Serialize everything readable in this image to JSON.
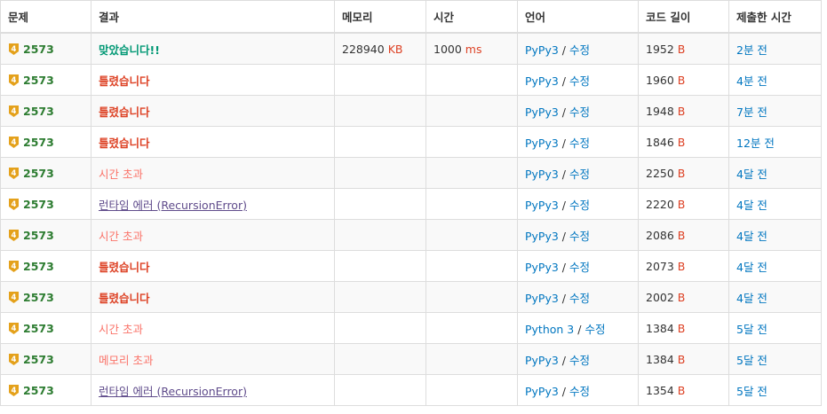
{
  "headers": [
    "문제",
    "결과",
    "메모리",
    "시간",
    "언어",
    "코드 길이",
    "제출한 시간"
  ],
  "tier_badge": "4",
  "colors": {
    "tier": "#e4a11b",
    "problem": "#2e7d32",
    "accepted": "#009874",
    "wrong": "#dd4124",
    "timeout": "#fa7268",
    "runtime": "#5f4b8b",
    "link": "#0076c0"
  },
  "rows": [
    {
      "problem": "2573",
      "result": "맞았습니다!!",
      "result_type": "ac",
      "memory": "228940",
      "memory_unit": "KB",
      "time": "1000",
      "time_unit": "ms",
      "language": "PyPy3",
      "edit": "수정",
      "length": "1952",
      "length_unit": "B",
      "submitted": "2분 전"
    },
    {
      "problem": "2573",
      "result": "틀렸습니다",
      "result_type": "wa",
      "memory": "",
      "memory_unit": "",
      "time": "",
      "time_unit": "",
      "language": "PyPy3",
      "edit": "수정",
      "length": "1960",
      "length_unit": "B",
      "submitted": "4분 전"
    },
    {
      "problem": "2573",
      "result": "틀렸습니다",
      "result_type": "wa",
      "memory": "",
      "memory_unit": "",
      "time": "",
      "time_unit": "",
      "language": "PyPy3",
      "edit": "수정",
      "length": "1948",
      "length_unit": "B",
      "submitted": "7분 전"
    },
    {
      "problem": "2573",
      "result": "틀렸습니다",
      "result_type": "wa",
      "memory": "",
      "memory_unit": "",
      "time": "",
      "time_unit": "",
      "language": "PyPy3",
      "edit": "수정",
      "length": "1846",
      "length_unit": "B",
      "submitted": "12분 전"
    },
    {
      "problem": "2573",
      "result": "시간 초과",
      "result_type": "tle",
      "memory": "",
      "memory_unit": "",
      "time": "",
      "time_unit": "",
      "language": "PyPy3",
      "edit": "수정",
      "length": "2250",
      "length_unit": "B",
      "submitted": "4달 전"
    },
    {
      "problem": "2573",
      "result": "런타임 에러 (RecursionError)",
      "result_type": "rte",
      "memory": "",
      "memory_unit": "",
      "time": "",
      "time_unit": "",
      "language": "PyPy3",
      "edit": "수정",
      "length": "2220",
      "length_unit": "B",
      "submitted": "4달 전"
    },
    {
      "problem": "2573",
      "result": "시간 초과",
      "result_type": "tle",
      "memory": "",
      "memory_unit": "",
      "time": "",
      "time_unit": "",
      "language": "PyPy3",
      "edit": "수정",
      "length": "2086",
      "length_unit": "B",
      "submitted": "4달 전"
    },
    {
      "problem": "2573",
      "result": "틀렸습니다",
      "result_type": "wa",
      "memory": "",
      "memory_unit": "",
      "time": "",
      "time_unit": "",
      "language": "PyPy3",
      "edit": "수정",
      "length": "2073",
      "length_unit": "B",
      "submitted": "4달 전"
    },
    {
      "problem": "2573",
      "result": "틀렸습니다",
      "result_type": "wa",
      "memory": "",
      "memory_unit": "",
      "time": "",
      "time_unit": "",
      "language": "PyPy3",
      "edit": "수정",
      "length": "2002",
      "length_unit": "B",
      "submitted": "4달 전"
    },
    {
      "problem": "2573",
      "result": "시간 초과",
      "result_type": "tle",
      "memory": "",
      "memory_unit": "",
      "time": "",
      "time_unit": "",
      "language": "Python 3",
      "edit": "수정",
      "length": "1384",
      "length_unit": "B",
      "submitted": "5달 전"
    },
    {
      "problem": "2573",
      "result": "메모리 초과",
      "result_type": "mle",
      "memory": "",
      "memory_unit": "",
      "time": "",
      "time_unit": "",
      "language": "PyPy3",
      "edit": "수정",
      "length": "1384",
      "length_unit": "B",
      "submitted": "5달 전"
    },
    {
      "problem": "2573",
      "result": "런타임 에러 (RecursionError)",
      "result_type": "rte",
      "memory": "",
      "memory_unit": "",
      "time": "",
      "time_unit": "",
      "language": "PyPy3",
      "edit": "수정",
      "length": "1354",
      "length_unit": "B",
      "submitted": "5달 전"
    }
  ]
}
